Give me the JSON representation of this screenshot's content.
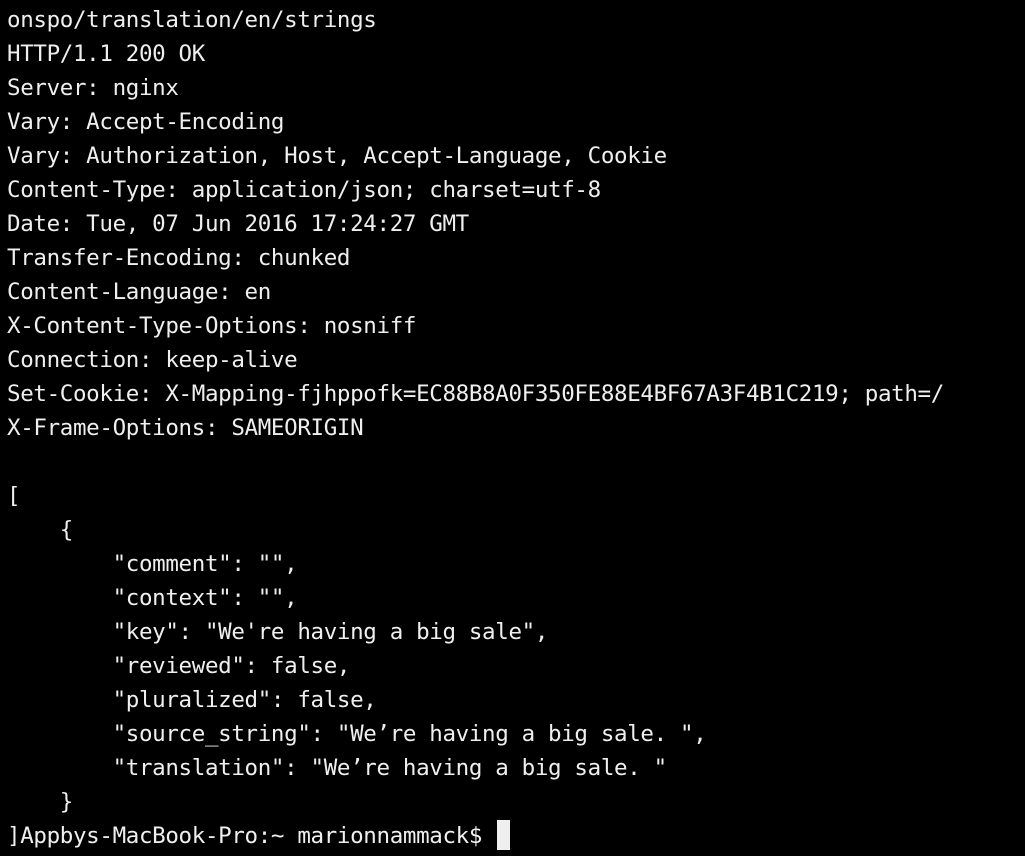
{
  "terminal": {
    "lines": [
      "onspo/translation/en/strings",
      "HTTP/1.1 200 OK",
      "Server: nginx",
      "Vary: Accept-Encoding",
      "Vary: Authorization, Host, Accept-Language, Cookie",
      "Content-Type: application/json; charset=utf-8",
      "Date: Tue, 07 Jun 2016 17:24:27 GMT",
      "Transfer-Encoding: chunked",
      "Content-Language: en",
      "X-Content-Type-Options: nosniff",
      "Connection: keep-alive",
      "Set-Cookie: X-Mapping-fjhppofk=EC88B8A0F350FE88E4BF67A3F4B1C219; path=/",
      "X-Frame-Options: SAMEORIGIN",
      "",
      "[",
      "    {",
      "        \"comment\": \"\",",
      "        \"context\": \"\",",
      "        \"key\": \"We're having a big sale\",",
      "        \"reviewed\": false,",
      "        \"pluralized\": false,",
      "        \"source_string\": \"We’re having a big sale. \",",
      "        \"translation\": \"We’re having a big sale. \"",
      "    }"
    ],
    "prompt": "]Appbys-MacBook-Pro:~ marionnammack$ ",
    "colors": {
      "background": "#000000",
      "foreground": "#efefef"
    }
  }
}
